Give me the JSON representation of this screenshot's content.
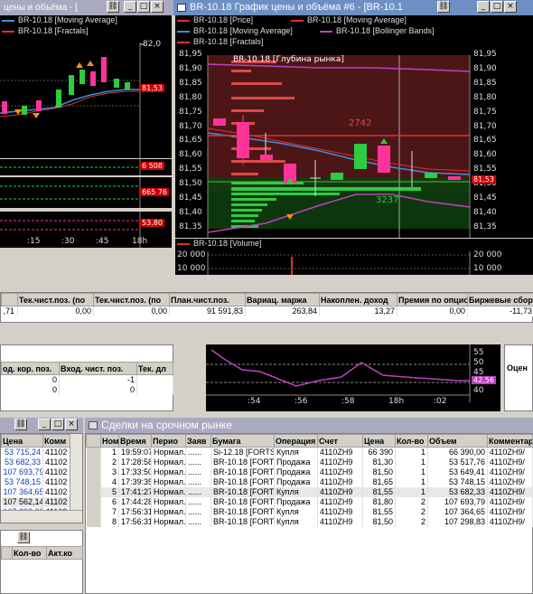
{
  "left_chart": {
    "title": "цены и объёма - [",
    "legend": [
      {
        "label": "BR-10.18 [Moving Average]",
        "color": "#3a8ee6"
      },
      {
        "label": "BR-10.18 [Fractals]",
        "color": "#e03030"
      }
    ],
    "y_labels": [
      "82,0"
    ],
    "price_tag": "81,53",
    "mini_tags": [
      "6 508",
      "665 76",
      "53,80"
    ],
    "x_labels": [
      ":15",
      ":30",
      ":45",
      "18h"
    ]
  },
  "main_chart": {
    "title": "BR-10.18 График цены и объёма #6 - [BR-10.1",
    "legend": [
      {
        "label": "BR-10.18 [Price]",
        "color": "#e03030"
      },
      {
        "label": "BR-10.18 [Moving Average]",
        "color": "#e03030"
      },
      {
        "label": "BR-10.18 [Moving Average]",
        "color": "#3a8ee6"
      },
      {
        "label": "BR-10.18 [Bollinger Bands]",
        "color": "#c040c0"
      },
      {
        "label": "BR-10.18 [Fractals]",
        "color": "#e03030"
      }
    ],
    "y_labels": [
      "81,95",
      "81,90",
      "81,85",
      "81,80",
      "81,75",
      "81,70",
      "81,65",
      "81,60",
      "81,55",
      "81,50",
      "81,45",
      "81,40",
      "81,35"
    ],
    "depth_label": "BR-10.18 [Глубина рынка]",
    "depth_ask": "2742",
    "depth_bid": "3237",
    "price_tag": "81,53",
    "volume_label": "BR-10.18 [Volume]",
    "volume_y": [
      "20 000",
      "10 000"
    ]
  },
  "positions": {
    "headers": [
      "Тек.чист.поз. (по",
      "Тек.чист.поз. (по",
      "План.чист.поз.",
      "Вариац. маржа",
      "Накоплен. доход",
      "Премия по опцио",
      "Биржевые сбор"
    ],
    "values": [
      "0,00",
      "0,00",
      "91 591,83",
      "263,84",
      "13,27",
      "0,00",
      "-11,73"
    ],
    "lead_value": ",71"
  },
  "mid_left": {
    "headers": [
      "од. кор. поз.",
      "Вход. чист. поз.",
      "Тек. дл"
    ],
    "rows": [
      [
        "0",
        "-1",
        ""
      ],
      [
        "0",
        "0",
        ""
      ]
    ]
  },
  "indicator": {
    "y_labels": [
      "55",
      "50",
      "45",
      "40"
    ],
    "tag": "42,56",
    "x_labels": [
      ":54",
      ":56",
      ":58",
      "18h",
      ":02"
    ]
  },
  "mid_right": {
    "header": "Оцен"
  },
  "small_left": {
    "headers": [
      "Цена",
      "Комм"
    ],
    "rows": [
      [
        "53 715,24",
        "41102"
      ],
      [
        "53 682,33",
        "41102"
      ],
      [
        "107 693,79",
        "41102"
      ],
      [
        "53 748,15",
        "41102"
      ],
      [
        "107 364,65",
        "41102"
      ],
      [
        "107 562,14",
        "41102"
      ],
      [
        "107 298,83",
        "41102"
      ]
    ]
  },
  "small_left_bottom": {
    "headers": [
      "Кол-во",
      "Акт.ко"
    ]
  },
  "deals": {
    "title": "Сделки на срочном рынке",
    "headers": [
      "Ном",
      "Время",
      "Перио",
      "Заяв",
      "Бумага",
      "Операция",
      "Счет",
      "Цена",
      "Кол-во",
      "Объем",
      "Комментар"
    ],
    "rows": [
      [
        "1",
        "19:59:07",
        "Нормал...",
        "......",
        "Si-12.18 [FORTS]",
        "Купля",
        "4110ZH9",
        "66 390",
        "1",
        "66 390,00",
        "4110ZH9/"
      ],
      [
        "2",
        "17:28:58",
        "Нормал...",
        "......",
        "BR-10.18 [FORTS]",
        "Продажа",
        "4110ZH9",
        "81,30",
        "1",
        "53 517,76",
        "4110ZH9/"
      ],
      [
        "3",
        "17:33:50",
        "Нормал...",
        "......",
        "BR-10.18 [FORTS]",
        "Продажа",
        "4110ZH9",
        "81,50",
        "1",
        "53 649,41",
        "4110ZH9/"
      ],
      [
        "4",
        "17:39:35",
        "Нормал...",
        "......",
        "BR-10.18 [FORTS]",
        "Продажа",
        "4110ZH9",
        "81,65",
        "1",
        "53 748,15",
        "4110ZH9/"
      ],
      [
        "5",
        "17:41:27",
        "Нормал...",
        "......",
        "BR-10.18 [FORTS]",
        "Купля",
        "4110ZH9",
        "81,55",
        "1",
        "53 682,33",
        "4110ZH9/"
      ],
      [
        "6",
        "17:44:28",
        "Нормал...",
        "......",
        "BR-10.18 [FORTS]",
        "Продажа",
        "4110ZH9",
        "81,80",
        "2",
        "107 693,79",
        "4110ZH9/"
      ],
      [
        "7",
        "17:56:31",
        "Нормал...",
        "......",
        "BR-10.18 [FORTS]",
        "Купля",
        "4110ZH9",
        "81,55",
        "2",
        "107 364,65",
        "4110ZH9/"
      ],
      [
        "8",
        "17:56:31",
        "Нормал...",
        "......",
        "BR-10.18 [FORTS]",
        "Купля",
        "4110ZH9",
        "81,50",
        "2",
        "107 298,83",
        "4110ZH9/"
      ]
    ]
  }
}
